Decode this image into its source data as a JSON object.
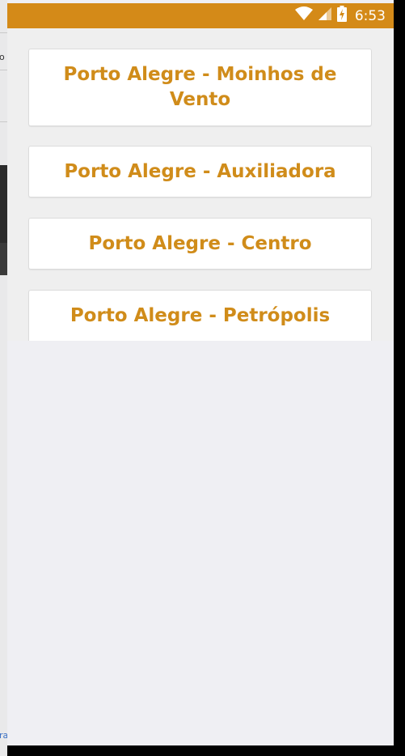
{
  "status_bar": {
    "time": "6:53",
    "color": "#d48a18",
    "icons": [
      "wifi-icon",
      "signal-icon",
      "battery-charging-icon"
    ]
  },
  "locations": {
    "accent_color": "#d08c1a",
    "items": [
      {
        "label": "Porto Alegre - Moinhos de Vento"
      },
      {
        "label": "Porto Alegre - Auxiliadora"
      },
      {
        "label": "Porto Alegre - Centro"
      },
      {
        "label": "Porto Alegre - Petrópolis"
      }
    ]
  },
  "background_window": {
    "fragments": [
      "o",
      "ra"
    ]
  }
}
